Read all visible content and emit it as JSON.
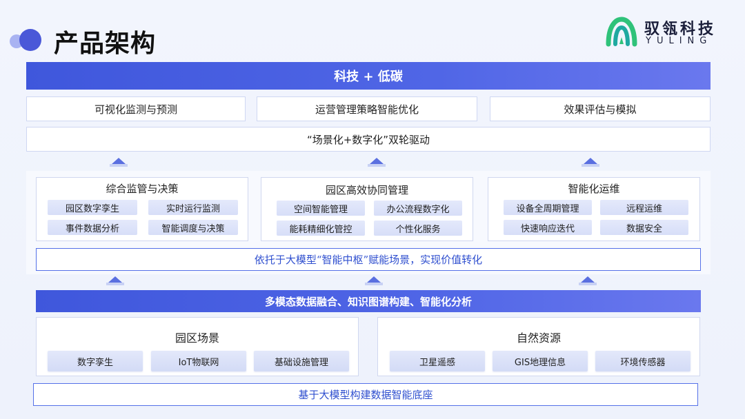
{
  "header": {
    "title": "产品架构",
    "logo_cn": "驭瓴科技",
    "logo_en": "YULING"
  },
  "top_banner": "科技 + 低碳",
  "top_boxes": [
    "可视化监测与预测",
    "运营管理策略智能优化",
    "效果评估与模拟"
  ],
  "drive_box": "“场景化+数字化”双轮驱动",
  "modules": [
    {
      "title": "综合监管与决策",
      "chips": [
        "园区数字孪生",
        "实时运行监测",
        "事件数据分析",
        "智能调度与决策"
      ]
    },
    {
      "title": "园区高效协同管理",
      "chips": [
        "空间智能管理",
        "办公流程数字化",
        "能耗精细化管控",
        "个性化服务"
      ]
    },
    {
      "title": "智能化运维",
      "chips": [
        "设备全周期管理",
        "远程运维",
        "快速响应迭代",
        "数据安全"
      ]
    }
  ],
  "hub_box": "依托于大模型“智能中枢”赋能场景，实现价值转化",
  "data_banner": "多模态数据融合、知识图谱构建、智能化分析",
  "base_modules": [
    {
      "title": "园区场景",
      "chips": [
        "数字孪生",
        "IoT物联网",
        "基础设施管理"
      ]
    },
    {
      "title": "自然资源",
      "chips": [
        "卫星遥感",
        "GIS地理信息",
        "环境传感器"
      ]
    }
  ],
  "foundation_box": "基于大模型构建数据智能底座",
  "colors": {
    "accent": "#4a5fe0",
    "accent_text": "#2f4fcf"
  }
}
